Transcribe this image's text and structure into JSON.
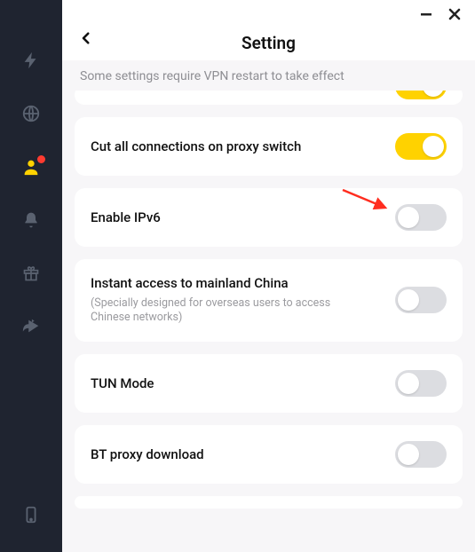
{
  "window": {
    "title": "Setting",
    "notice": "Some settings require VPN restart to take effect"
  },
  "colors": {
    "accent": "#ffd200",
    "sidebar_bg": "#1f2430",
    "inactive_icon": "#5a6270",
    "notice_text": "#8e8e93",
    "arrow": "#ff2d1f"
  },
  "sidebar": {
    "items": [
      {
        "name": "bolt",
        "active": false,
        "dot": false
      },
      {
        "name": "globe",
        "active": false,
        "dot": false
      },
      {
        "name": "user",
        "active": true,
        "dot": true
      },
      {
        "name": "bell",
        "active": false,
        "dot": false
      },
      {
        "name": "gift",
        "active": false,
        "dot": false
      },
      {
        "name": "share",
        "active": false,
        "dot": false
      }
    ],
    "bottom": {
      "name": "devices"
    }
  },
  "settings": [
    {
      "id": "peek",
      "label": "",
      "sub": "",
      "on": true,
      "peek": true
    },
    {
      "id": "cut_conn",
      "label": "Cut all connections on proxy switch",
      "sub": "",
      "on": true
    },
    {
      "id": "ipv6",
      "label": "Enable IPv6",
      "sub": "",
      "on": false,
      "highlight_arrow": true
    },
    {
      "id": "cn_access",
      "label": "Instant access to mainland China",
      "sub": "(Specially designed for overseas users to access Chinese networks)",
      "on": false
    },
    {
      "id": "tun",
      "label": "TUN Mode",
      "sub": "",
      "on": false
    },
    {
      "id": "bt",
      "label": "BT proxy download",
      "sub": "",
      "on": false
    },
    {
      "id": "next",
      "label": "",
      "sub": "",
      "on": false,
      "peek_bottom": true
    }
  ]
}
